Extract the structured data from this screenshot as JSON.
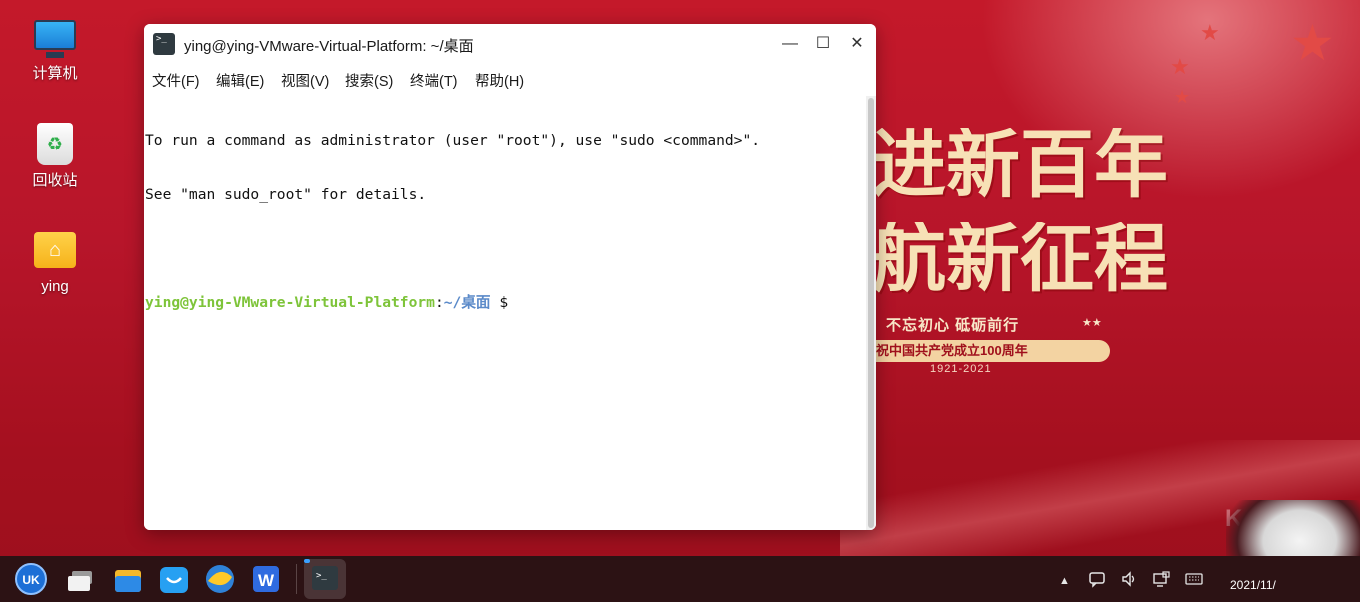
{
  "desktop": {
    "icons": [
      {
        "label": "计算机",
        "icon": "computer-icon"
      },
      {
        "label": "回收站",
        "icon": "trash-icon"
      },
      {
        "label": "ying",
        "icon": "home-folder-icon"
      }
    ],
    "wallpaper": {
      "slogan_line1": "进新百年",
      "slogan_line2": "航新征程",
      "subtitle": "不忘初心 砥砺前行",
      "ribbon": "祝中国共产党成立100周年",
      "years": "1921-2021",
      "stars": "★★",
      "watermark": "K"
    }
  },
  "terminal": {
    "title": "ying@ying-VMware-Virtual-Platform: ~/桌面",
    "icon": "terminal-icon",
    "menu": [
      "文件(F)",
      "编辑(E)",
      "视图(V)",
      "搜索(S)",
      "终端(T)",
      "帮助(H)"
    ],
    "lines": [
      "To run a command as administrator (user \"root\"), use \"sudo <command>\".",
      "See \"man sudo_root\" for details."
    ],
    "prompt": {
      "user_host": "ying@ying-VMware-Virtual-Platform",
      "colon": ":",
      "path": "~/桌面",
      "symbol": "$"
    }
  },
  "taskbar": {
    "apps": [
      "start-menu-icon",
      "multitask-view-icon",
      "file-manager-icon",
      "app-store-icon",
      "browser-icon",
      "wps-icon",
      "terminal-icon"
    ],
    "tray": [
      "tray-expand-icon",
      "notification-icon",
      "volume-icon",
      "network-icon",
      "keyboard-icon"
    ],
    "clock": "2021/11/"
  },
  "colors": {
    "prompt_user": "#7ec43a",
    "prompt_path": "#5b8ac9",
    "wallpaper_red": "#b7152a",
    "taskbar": "#2c1214"
  }
}
